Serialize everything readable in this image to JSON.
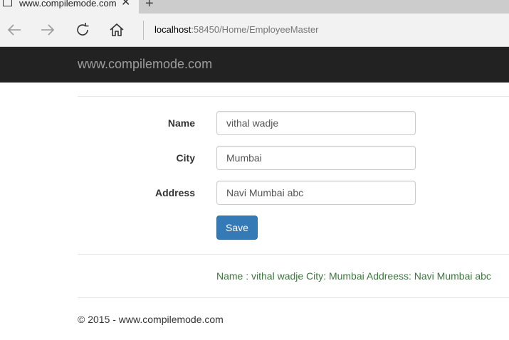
{
  "browser": {
    "tab_title": "www.compilemode.com",
    "address_host": "localhost",
    "address_rest": ":58450/Home/EmployeeMaster"
  },
  "navbar": {
    "brand": "www.compilemode.com"
  },
  "form": {
    "name_label": "Name",
    "name_value": "vithal wadje",
    "city_label": "City",
    "city_value": "Mumbai",
    "address_label": "Address",
    "address_value": "Navi Mumbai abc",
    "save_label": "Save"
  },
  "result": {
    "text": "Name : vithal wadje City: Mumbai Addreess: Navi Mumbai abc"
  },
  "footer": {
    "text": "© 2015 - www.compilemode.com"
  },
  "icons": {
    "back": "arrow-left-icon",
    "forward": "arrow-right-icon",
    "refresh": "refresh-icon",
    "home": "home-icon",
    "close": "close-icon",
    "new_tab": "plus-icon"
  },
  "colors": {
    "navbar_bg": "#222222",
    "brand_text": "#9d9d9d",
    "button_bg": "#337ab7",
    "result_text": "#3c763d"
  }
}
